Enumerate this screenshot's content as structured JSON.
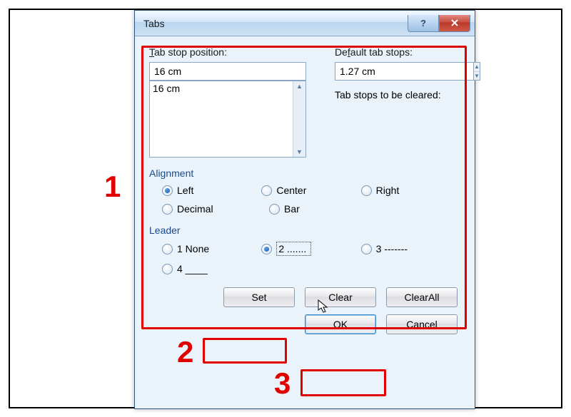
{
  "dialog": {
    "title": "Tabs",
    "tabstop_label": "Tab stop position:",
    "tabstop_value": "16 cm",
    "tabstop_list": [
      "16 cm"
    ],
    "default_label": "Default tab stops:",
    "default_value": "1.27 cm",
    "cleared_label": "Tab stops to be cleared:"
  },
  "alignment": {
    "title": "Alignment",
    "left": "Left",
    "center": "Center",
    "right": "Right",
    "decimal": "Decimal",
    "bar": "Bar",
    "selected": "left"
  },
  "leader": {
    "title": "Leader",
    "opt1": "1 None",
    "opt2": "2 .......",
    "opt3": "3 -------",
    "opt4": "4 ____",
    "selected": "2"
  },
  "buttons": {
    "set": "Set",
    "clear": "Clear",
    "clear_all": "Clear All",
    "ok": "OK",
    "cancel": "Cancel"
  },
  "annotations": {
    "n1": "1",
    "n2": "2",
    "n3": "3"
  }
}
